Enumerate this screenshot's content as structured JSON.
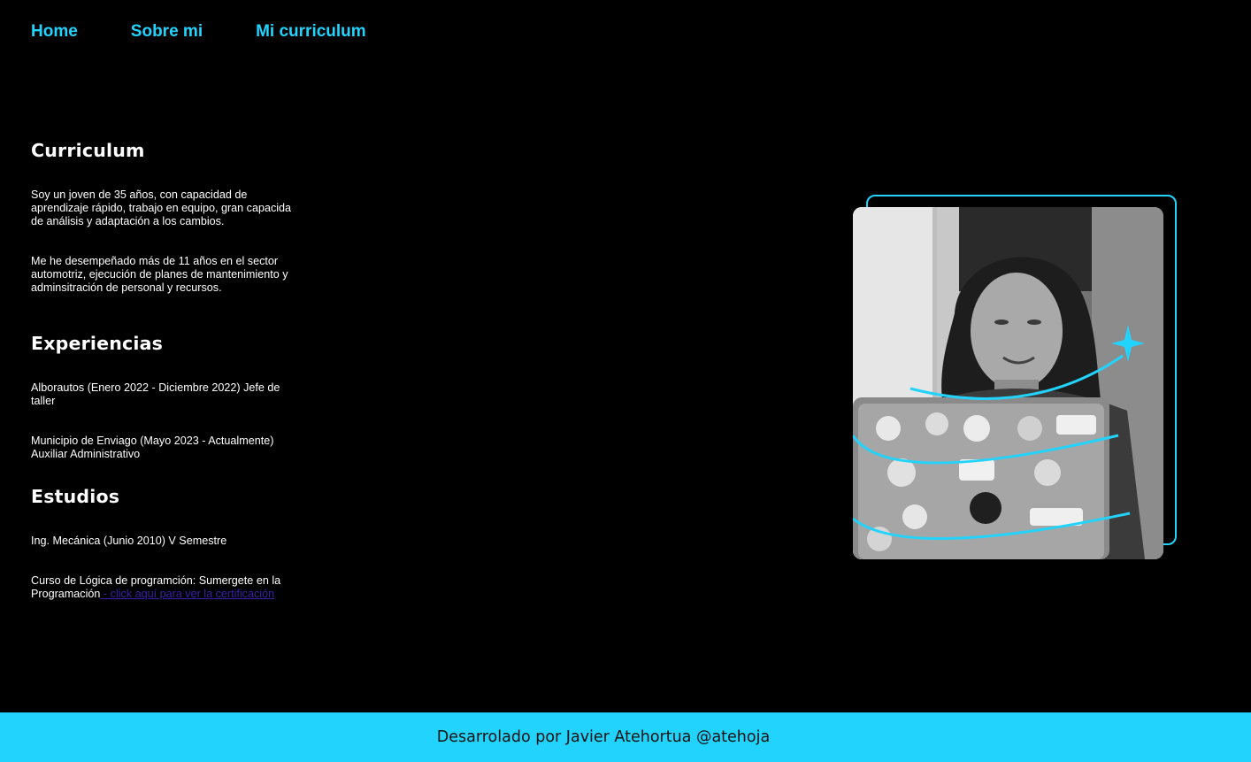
{
  "nav": {
    "home": "Home",
    "about": "Sobre mi",
    "cv": "Mi curriculum"
  },
  "curriculum": {
    "title": "Curriculum",
    "paragraph_1": "Soy un joven de 35 años, con capacidad de aprendizaje rápido, trabajo en equipo, gran capacida de análisis y adaptación a los cambios.",
    "paragraph_2": "Me he desempeñado más de 11 años en el sector automotriz, ejecución de planes de mantenimiento y adminsitración de personal y recursos."
  },
  "experiences": {
    "title": "Experiencias",
    "items": [
      "Alborautos (Enero 2022 - Diciembre 2022) Jefe de taller",
      "Municipio de Enviago (Mayo 2023 - Actualmente) Auxiliar Administrativo"
    ]
  },
  "studies": {
    "title": "Estudios",
    "item_1": "Ing. Mecánica (Junio 2010) V Semestre",
    "item_2_text": "Curso de Lógica de programción: Sumergete en la Programación",
    "item_2_link": " - click aquí para ver la certificación"
  },
  "footer": {
    "text": "Desarrolado por Javier Atehortua @atehoja"
  },
  "colors": {
    "accent": "#22d4fd",
    "background": "#000000",
    "link": "#3b1fa8"
  }
}
